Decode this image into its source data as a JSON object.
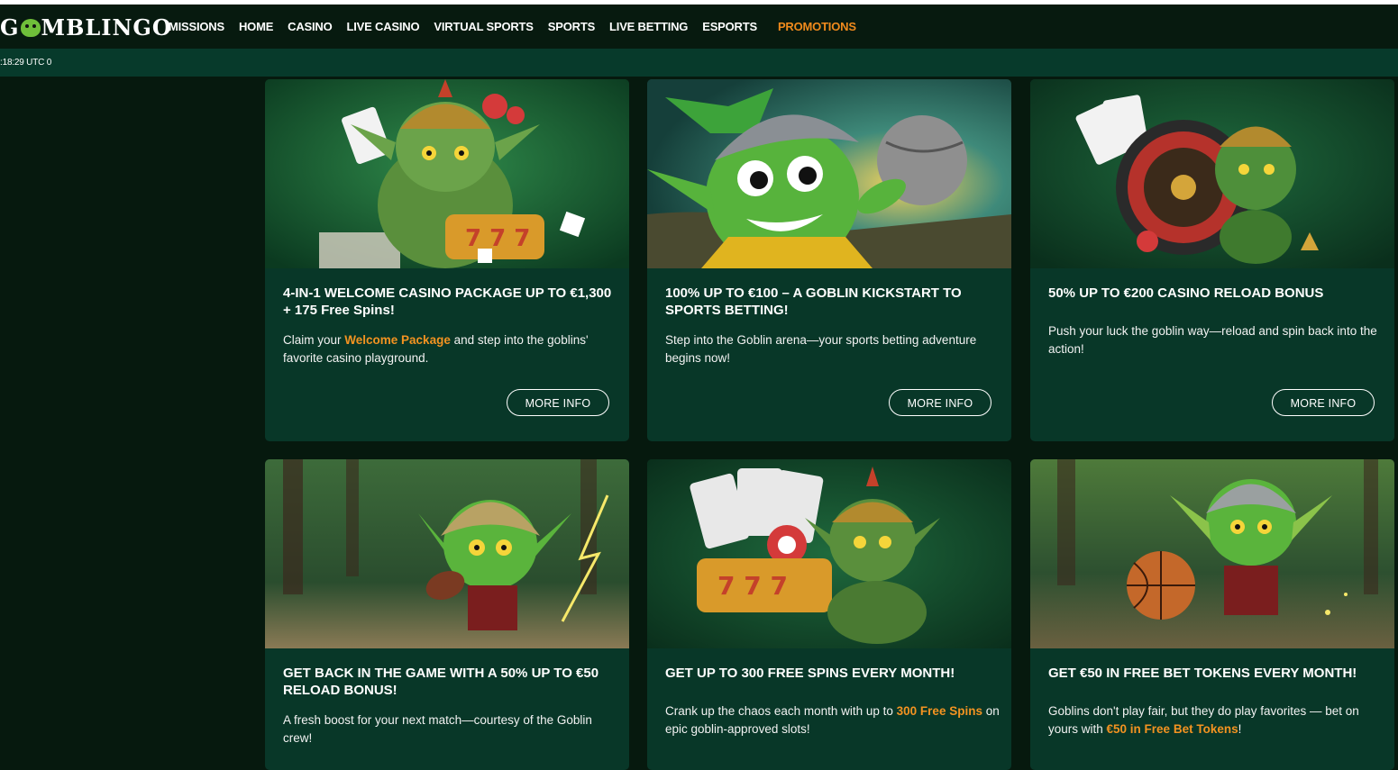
{
  "brand": {
    "logo_text_left": "G",
    "logo_text_right": "MBLINGO"
  },
  "nav": {
    "items": [
      "MISSIONS",
      "HOME",
      "CASINO",
      "LIVE CASINO",
      "VIRTUAL SPORTS",
      "SPORTS",
      "LIVE BETTING",
      "ESPORTS"
    ],
    "promotions": "PROMOTIONS"
  },
  "status": {
    "time": ":18:29 UTC 0"
  },
  "promos": [
    {
      "title": "4-IN-1 WELCOME CASINO PACKAGE UP TO €1,300 + 175 Free Spins!",
      "desc_pre": "Claim your ",
      "desc_hl": "Welcome Package",
      "desc_post": " and step into the goblins' favorite casino playground.",
      "button": "MORE INFO"
    },
    {
      "title": "100% UP TO €100 – A GOBLIN KICKSTART TO SPORTS BETTING!",
      "desc_pre": "Step into the Goblin arena—your sports betting adventure begins now!",
      "desc_hl": "",
      "desc_post": "",
      "button": "MORE INFO"
    },
    {
      "title": "50% UP TO €200 CASINO RELOAD BONUS",
      "desc_pre": "Push your luck the goblin way—reload and spin back into the action!",
      "desc_hl": "",
      "desc_post": "",
      "button": "MORE INFO"
    },
    {
      "title": "GET BACK IN THE GAME WITH A 50% UP TO €50 RELOAD BONUS!",
      "desc_pre": "A fresh boost for your next match—courtesy of the Goblin crew!",
      "desc_hl": "",
      "desc_post": ""
    },
    {
      "title": "GET UP TO 300 FREE SPINS EVERY MONTH!",
      "desc_pre": "Crank up the chaos each month with up to ",
      "desc_hl": "300 Free Spins",
      "desc_post": " on epic goblin-approved slots!"
    },
    {
      "title": "GET €50 IN FREE BET TOKENS EVERY MONTH!",
      "desc_pre": "Goblins don't play fair, but they do play favorites — bet on yours with ",
      "desc_hl": "€50 in Free Bet Tokens",
      "desc_post": "!"
    }
  ],
  "colors": {
    "accent": "#f08a1c",
    "card_bg": "#083728",
    "page_bg": "#06190e"
  }
}
